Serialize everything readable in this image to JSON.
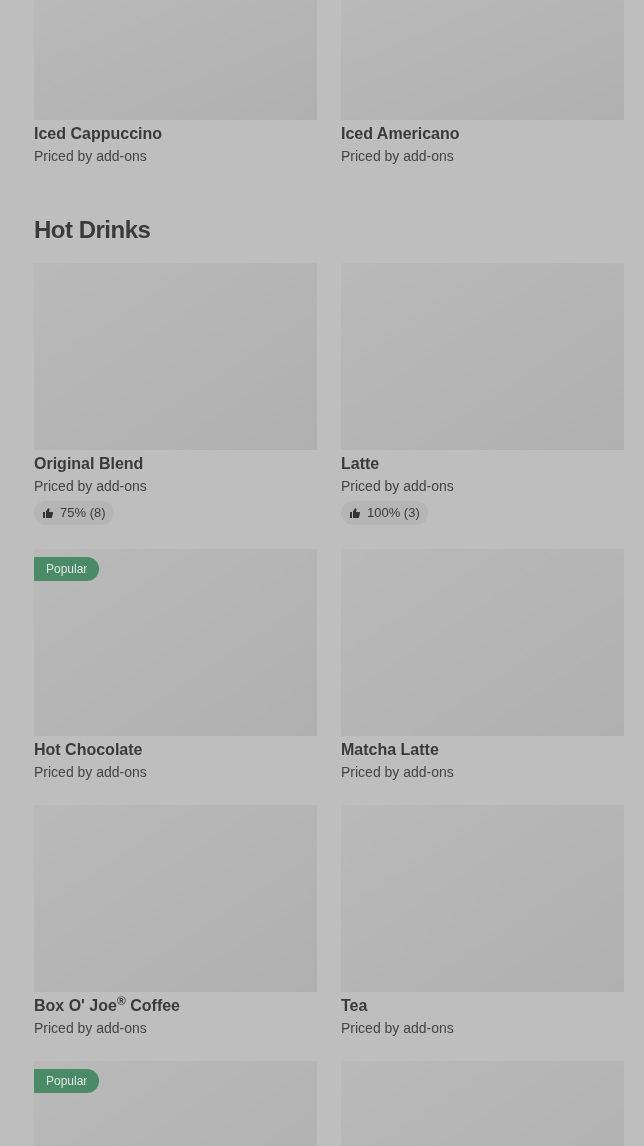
{
  "sections": [
    {
      "items": [
        {
          "kind": "product",
          "name": "Iced Cappuccino",
          "subtitle": "Priced by add-ons"
        },
        {
          "kind": "product",
          "name": "Iced Americano",
          "subtitle": "Priced by add-ons"
        }
      ]
    },
    {
      "heading": "Hot Drinks",
      "items": [
        {
          "kind": "product",
          "name": "Original Blend",
          "subtitle": "Priced by add-ons",
          "rating": "75% (8)"
        },
        {
          "kind": "product",
          "name": "Latte",
          "subtitle": "Priced by add-ons",
          "rating": "100% (3)"
        },
        {
          "kind": "product",
          "name": "Hot Chocolate",
          "subtitle": "Priced by add-ons",
          "badge": "Popular"
        },
        {
          "kind": "product",
          "name": "Matcha Latte",
          "subtitle": "Priced by add-ons"
        },
        {
          "kind": "product",
          "name": "Box O' Joe$^{®}$ Coffee",
          "subtitle": "Priced by add-ons"
        },
        {
          "kind": "product",
          "name": "Tea",
          "subtitle": "Priced by add-ons"
        },
        {
          "kind": "product",
          "badge": "Popular"
        },
        {
          "kind": "product"
        }
      ]
    }
  ]
}
